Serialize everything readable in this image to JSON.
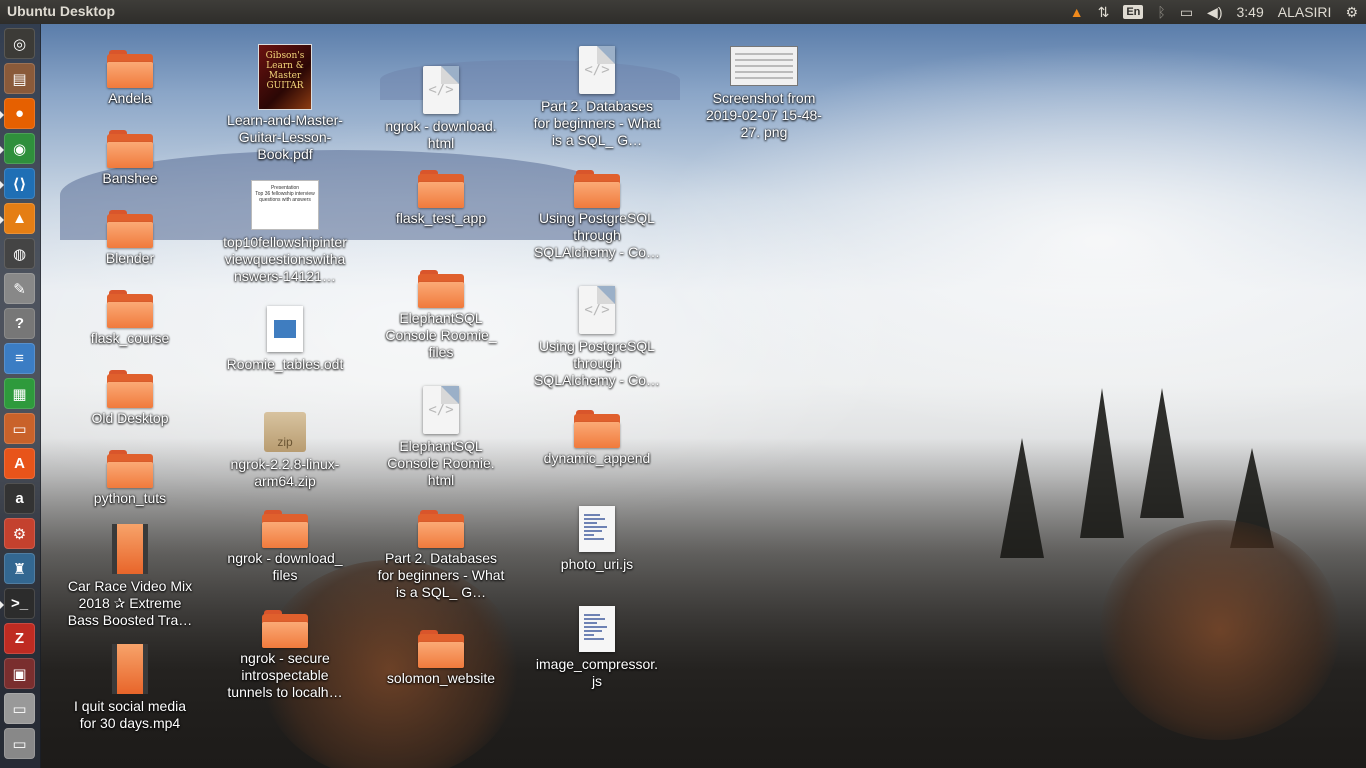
{
  "top_panel": {
    "title": "Ubuntu Desktop",
    "language": "En",
    "clock": "3:49",
    "user": "ALASIRI"
  },
  "launcher": {
    "items": [
      {
        "name": "ubuntu-dash",
        "glyph": "◎",
        "color": "#3c3b37"
      },
      {
        "name": "files",
        "glyph": "▤",
        "color": "#8a5a3a"
      },
      {
        "name": "firefox",
        "glyph": "●",
        "color": "#e66000"
      },
      {
        "name": "chrome",
        "glyph": "◉",
        "color": "#2f8f3c"
      },
      {
        "name": "vscode",
        "glyph": "⟨⟩",
        "color": "#1f6fb5"
      },
      {
        "name": "vlc",
        "glyph": "▲",
        "color": "#e57e14"
      },
      {
        "name": "media-player",
        "glyph": "◍",
        "color": "#444"
      },
      {
        "name": "editor",
        "glyph": "✎",
        "color": "#888"
      },
      {
        "name": "help",
        "glyph": "?",
        "color": "#777"
      },
      {
        "name": "writer",
        "glyph": "≡",
        "color": "#3b7dc4"
      },
      {
        "name": "calc",
        "glyph": "▦",
        "color": "#2e9a3c"
      },
      {
        "name": "impress",
        "glyph": "▭",
        "color": "#c9622a"
      },
      {
        "name": "software-center",
        "glyph": "A",
        "color": "#e8541a"
      },
      {
        "name": "amazon",
        "glyph": "a",
        "color": "#333"
      },
      {
        "name": "settings",
        "glyph": "⚙",
        "color": "#c4412e"
      },
      {
        "name": "postgres",
        "glyph": "♜",
        "color": "#336791"
      },
      {
        "name": "terminal",
        "glyph": ">_",
        "color": "#2c2c2c"
      },
      {
        "name": "filezilla",
        "glyph": "Z",
        "color": "#bf2b22"
      },
      {
        "name": "app",
        "glyph": "▣",
        "color": "#7a2e2e"
      },
      {
        "name": "drive",
        "glyph": "▭",
        "color": "#999"
      },
      {
        "name": "drive2",
        "glyph": "▭",
        "color": "#888"
      }
    ]
  },
  "desktop_icons": [
    {
      "id": "andela",
      "type": "folder",
      "label": "Andela"
    },
    {
      "id": "banshee",
      "type": "folder",
      "label": "Banshee"
    },
    {
      "id": "blender",
      "type": "folder",
      "label": "Blender"
    },
    {
      "id": "flask-course",
      "type": "folder",
      "label": "flask_course"
    },
    {
      "id": "old-desktop",
      "type": "folder",
      "label": "Old Desktop"
    },
    {
      "id": "python-tuts",
      "type": "folder",
      "label": "python_tuts"
    },
    {
      "id": "car-race",
      "type": "video",
      "label": "Car Race Video Mix 2018 ✰ Extreme Bass Boosted Tra…"
    },
    {
      "id": "quit-social",
      "type": "video",
      "label": "I quit social media for 30 days.mp4"
    },
    {
      "id": "guitar-pdf",
      "type": "pdf",
      "label": "Learn-and-Master-Guitar-Lesson-Book.pdf",
      "thumb_text": "Gibson's Learn & Master GUITAR"
    },
    {
      "id": "fellowship",
      "type": "thumb",
      "label": "top10fellowshipinterviewquestionswithanswers-14121…",
      "thumb_title": "Presentation",
      "thumb_text": "Top 36 fellowship interview questions with answers"
    },
    {
      "id": "roomie-odt",
      "type": "odt",
      "label": "Roomie_tables.odt"
    },
    {
      "id": "ngrok-zip",
      "type": "zip",
      "label": "ngrok-2.2.8-linux-arm64.zip",
      "thumb_text": "zip"
    },
    {
      "id": "ngrok-files",
      "type": "folder",
      "label": "ngrok - download_ files"
    },
    {
      "id": "ngrok-secure",
      "type": "folder",
      "label": "ngrok - secure introspectable tunnels to localh…"
    },
    {
      "id": "ngrok-html",
      "type": "html",
      "label": "ngrok - download. html"
    },
    {
      "id": "flask-test",
      "type": "folder",
      "label": "flask_test_app"
    },
    {
      "id": "elephant-files",
      "type": "folder",
      "label": "ElephantSQL Console Roomie_ files"
    },
    {
      "id": "elephant-html",
      "type": "html",
      "label": "ElephantSQL Console Roomie. html"
    },
    {
      "id": "part2-folder",
      "type": "folder",
      "label": "Part 2. Databases for beginners - What is a SQL_ G…"
    },
    {
      "id": "solomon",
      "type": "folder",
      "label": "solomon_website"
    },
    {
      "id": "part2-html",
      "type": "html",
      "label": "Part 2. Databases for beginners - What is a SQL_ G…"
    },
    {
      "id": "postgres-folder",
      "type": "folder",
      "label": "Using PostgreSQL through SQLAlchemy - Co…"
    },
    {
      "id": "postgres-html",
      "type": "html",
      "label": "Using PostgreSQL through SQLAlchemy - Co…"
    },
    {
      "id": "dynamic-append",
      "type": "folder",
      "label": "dynamic_append"
    },
    {
      "id": "photo-uri",
      "type": "js",
      "label": "photo_uri.js"
    },
    {
      "id": "image-compressor",
      "type": "js",
      "label": "image_compressor. js"
    },
    {
      "id": "screenshot",
      "type": "screenshot",
      "label": "Screenshot from 2019-02-07 15-48-27. png"
    }
  ],
  "colors": {
    "panel": "#2e2d2a",
    "folder": "#f07a3c",
    "text": "#ffffff"
  }
}
